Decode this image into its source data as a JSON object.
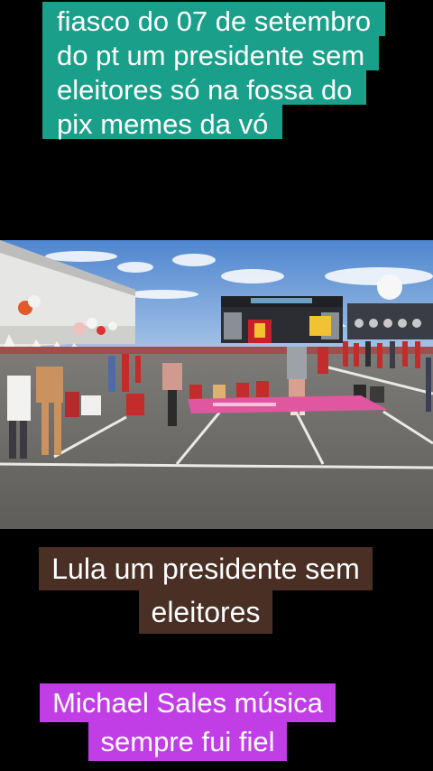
{
  "captions": {
    "top": {
      "lines": [
        "fiasco do 07 de setembro",
        "do pt   um presidente sem",
        "eleitores  só na fossa do",
        "pix memes da vó"
      ],
      "background": "#1aa08a"
    },
    "middle": {
      "lines": [
        "Lula um presidente sem",
        "eleitores"
      ],
      "background": "#4a2f25"
    },
    "bottom": {
      "lines": [
        "Michael Sales música",
        "sempre fui fiel"
      ],
      "background": "#c13ee6"
    }
  },
  "photo": {
    "colors": {
      "sky": "#6f9fd8",
      "ground": "#6f6f6c",
      "banner": "#e0579f",
      "stage": "#2b2d33"
    }
  }
}
